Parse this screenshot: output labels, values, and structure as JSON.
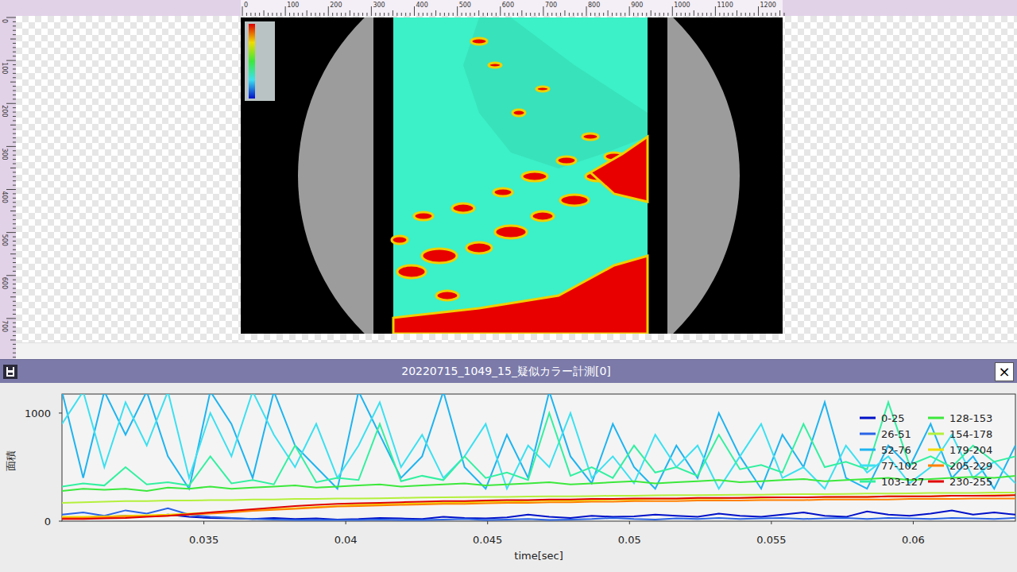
{
  "ruler": {
    "top_labels": [
      "0",
      "100",
      "200",
      "300",
      "400",
      "500",
      "600",
      "700",
      "800",
      "900",
      "1000",
      "1100",
      "1200"
    ],
    "left_labels": [
      "0",
      "100",
      "200",
      "300",
      "400",
      "500",
      "600",
      "700"
    ]
  },
  "window": {
    "title": "20220715_1049_15_疑似カラー計測[0]",
    "close": "×"
  },
  "chart": {
    "y_axis_label": "面積",
    "x_axis_label": "time[sec]",
    "x_min": 0.03,
    "x_max": 0.0636,
    "y_max": 1176,
    "y_ticks": [
      {
        "label": "1000",
        "value": 1000
      },
      {
        "label": "0",
        "value": 0
      }
    ],
    "x_ticks": [
      {
        "label": "0.035",
        "value": 0.035
      },
      {
        "label": "0.04",
        "value": 0.04
      },
      {
        "label": "0.045",
        "value": 0.045
      },
      {
        "label": "0.05",
        "value": 0.05
      },
      {
        "label": "0.055",
        "value": 0.055
      },
      {
        "label": "0.06",
        "value": 0.06
      }
    ],
    "series": [
      {
        "name": "0-25",
        "color": "#0010c8",
        "values": [
          30,
          35,
          40,
          50,
          45,
          60,
          40,
          30,
          25,
          20,
          30,
          20,
          25,
          15,
          20,
          30,
          25,
          20,
          40,
          30,
          25,
          35,
          60,
          40,
          30,
          50,
          40,
          45,
          60,
          50,
          40,
          70,
          50,
          40,
          60,
          80,
          50,
          40,
          90,
          60,
          50,
          70,
          100,
          60,
          80,
          60
        ]
      },
      {
        "name": "26-51",
        "color": "#2a64e6",
        "values": [
          60,
          80,
          50,
          100,
          70,
          120,
          60,
          40,
          30,
          20,
          15,
          10,
          10,
          10,
          10,
          15,
          10,
          10,
          15,
          20,
          10,
          15,
          20,
          10,
          15,
          20,
          30,
          20,
          15,
          25,
          20,
          30,
          20,
          25,
          30,
          20,
          25,
          30,
          20,
          30,
          25,
          20,
          30,
          25,
          20,
          30
        ]
      },
      {
        "name": "52-76",
        "color": "#1eb4f0",
        "values": [
          1200,
          400,
          1200,
          800,
          1200,
          600,
          300,
          1200,
          900,
          400,
          1200,
          700,
          500,
          300,
          1200,
          800,
          400,
          600,
          1200,
          500,
          300,
          800,
          400,
          1200,
          600,
          350,
          900,
          500,
          300,
          700,
          400,
          1000,
          600,
          300,
          800,
          500,
          1100,
          400,
          300,
          700,
          500,
          900,
          400,
          600,
          300,
          700
        ]
      },
      {
        "name": "77-102",
        "color": "#3ce0f0",
        "values": [
          900,
          1200,
          500,
          1100,
          700,
          1200,
          400,
          1000,
          600,
          1200,
          800,
          500,
          900,
          400,
          700,
          1100,
          500,
          800,
          400,
          600,
          900,
          300,
          700,
          500,
          1000,
          400,
          600,
          350,
          800,
          500,
          700,
          300,
          600,
          900,
          400,
          500,
          300,
          700,
          450,
          600,
          350,
          500,
          800,
          400,
          550,
          350
        ]
      },
      {
        "name": "103-127",
        "color": "#32f0a0",
        "values": [
          320,
          350,
          330,
          500,
          340,
          360,
          330,
          600,
          350,
          380,
          340,
          700,
          360,
          400,
          380,
          900,
          370,
          420,
          380,
          600,
          400,
          450,
          380,
          1000,
          420,
          500,
          400,
          700,
          450,
          500,
          420,
          800,
          480,
          520,
          450,
          900,
          500,
          550,
          480,
          1100,
          520,
          600,
          500,
          700,
          550,
          600
        ]
      },
      {
        "name": "128-153",
        "color": "#3ce83c",
        "values": [
          280,
          300,
          290,
          300,
          280,
          310,
          300,
          320,
          300,
          310,
          320,
          330,
          310,
          320,
          330,
          340,
          320,
          330,
          340,
          350,
          330,
          340,
          350,
          360,
          340,
          350,
          360,
          370,
          350,
          360,
          370,
          380,
          360,
          370,
          380,
          390,
          370,
          380,
          390,
          400,
          380,
          390,
          400,
          410,
          400,
          420
        ]
      },
      {
        "name": "154-178",
        "color": "#b4f03c",
        "values": [
          170,
          175,
          180,
          185,
          185,
          190,
          190,
          195,
          195,
          200,
          200,
          205,
          205,
          210,
          210,
          212,
          215,
          218,
          220,
          222,
          225,
          225,
          228,
          230,
          230,
          232,
          235,
          235,
          238,
          240,
          240,
          242,
          245,
          245,
          248,
          250,
          250,
          252,
          255,
          255,
          258,
          260,
          260,
          262,
          265,
          265
        ]
      },
      {
        "name": "179-204",
        "color": "#f0dc00",
        "values": [
          40,
          40,
          45,
          50,
          55,
          60,
          70,
          80,
          90,
          100,
          110,
          120,
          130,
          140,
          150,
          155,
          160,
          165,
          170,
          175,
          180,
          180,
          185,
          190,
          190,
          195,
          200,
          200,
          205,
          205,
          210,
          210,
          215,
          215,
          220,
          220,
          220,
          225,
          225,
          230,
          230,
          230,
          235,
          235,
          240,
          240
        ]
      },
      {
        "name": "205-229",
        "color": "#ff8000",
        "values": [
          30,
          30,
          35,
          40,
          45,
          50,
          60,
          70,
          80,
          95,
          105,
          115,
          125,
          135,
          140,
          145,
          150,
          155,
          160,
          160,
          165,
          170,
          170,
          175,
          175,
          180,
          180,
          185,
          185,
          185,
          190,
          190,
          190,
          195,
          195,
          195,
          200,
          200,
          200,
          200,
          205,
          205,
          205,
          210,
          210,
          210
        ]
      },
      {
        "name": "230-255",
        "color": "#e00000",
        "values": [
          20,
          20,
          25,
          30,
          40,
          50,
          65,
          80,
          95,
          110,
          125,
          140,
          150,
          160,
          165,
          170,
          175,
          180,
          185,
          185,
          190,
          195,
          195,
          200,
          200,
          205,
          205,
          210,
          210,
          210,
          215,
          215,
          215,
          220,
          220,
          220,
          225,
          225,
          225,
          230,
          230,
          230,
          235,
          235,
          235,
          240
        ]
      }
    ]
  }
}
